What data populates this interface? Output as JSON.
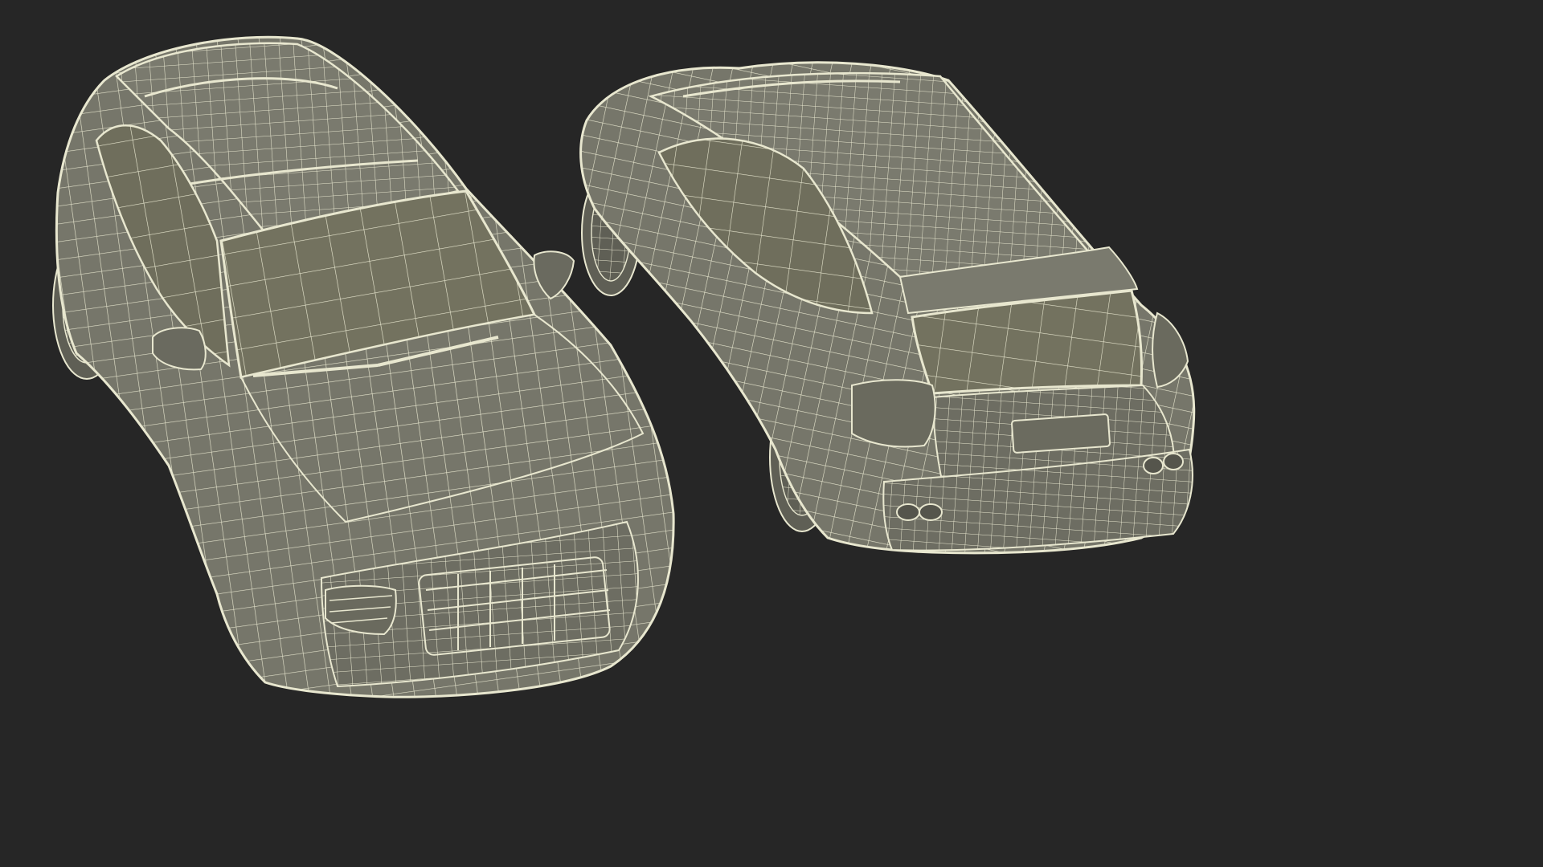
{
  "scene": {
    "background_color": "#262626",
    "wire_color": "#e8e7cf",
    "body_color": "#76766a",
    "body_dark_color": "#65655a",
    "glass_color": "#73725f",
    "objects": [
      {
        "name": "suv-wireframe-front-view",
        "icon": "car-front-wireframe"
      },
      {
        "name": "suv-wireframe-rear-view",
        "icon": "car-rear-wireframe"
      }
    ]
  }
}
